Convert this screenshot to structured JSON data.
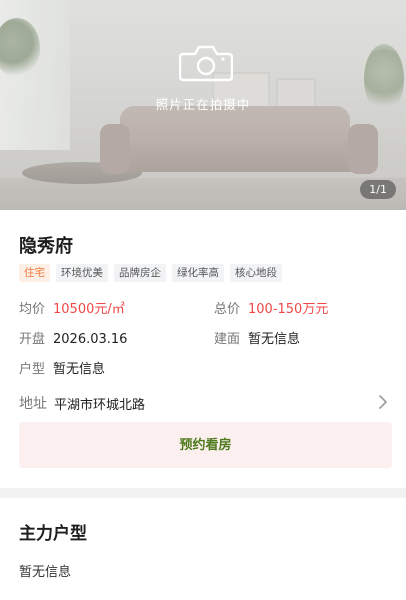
{
  "hero": {
    "caption": "照片正在拍摄中",
    "counter": "1/1",
    "icon": "camera-icon"
  },
  "property": {
    "name": "隐秀府",
    "tags": [
      "住宅",
      "环境优美",
      "品牌房企",
      "绿化率高",
      "核心地段"
    ],
    "avg_price_label": "均价",
    "avg_price_value": "10500元/㎡",
    "total_price_label": "总价",
    "total_price_value": "100-150万元",
    "open_label": "开盘",
    "open_value": "2026.03.16",
    "build_area_label": "建面",
    "build_area_value": "暂无信息",
    "layout_label": "户型",
    "layout_value": "暂无信息",
    "address_label": "地址",
    "address_value": "平湖市环城北路",
    "book_button": "预约看房"
  },
  "main_layout": {
    "title": "主力户型",
    "body": "暂无信息"
  },
  "colors": {
    "price_red": "#f04848",
    "tag_orange": "#f07b3f",
    "button_text_green": "#4f7a1e",
    "button_bg": "#fbf0ef"
  }
}
